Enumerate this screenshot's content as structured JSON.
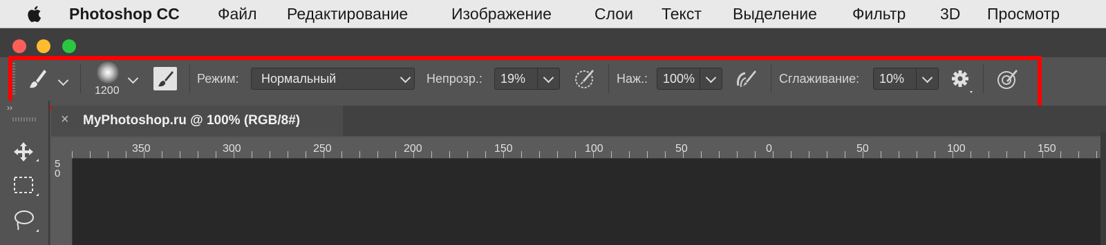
{
  "menubar": {
    "apple_icon": "apple-logo-icon",
    "app_name": "Photoshop CC",
    "items": [
      "Файл",
      "Редактирование",
      "Изображение",
      "Слои",
      "Текст",
      "Выделение",
      "Фильтр",
      "3D",
      "Просмотр"
    ]
  },
  "window": {
    "traffic_lights": {
      "close": "#fc5f57",
      "minimize": "#fdbc2e",
      "zoom": "#29c840"
    }
  },
  "options_bar": {
    "highlight_color": "#ff0000",
    "tool_icon": "brush-icon",
    "brush_size": "1200",
    "mode_label": "Режим:",
    "mode_value": "Нормальный",
    "opacity_label": "Непрозр.:",
    "opacity_value": "19%",
    "flow_label": "Наж.:",
    "flow_value": "100%",
    "smoothing_label": "Сглаживание:",
    "smoothing_value": "10%"
  },
  "document": {
    "tab_close": "×",
    "tab_title": "MyPhotoshop.ru @ 100% (RGB/8#)",
    "ruler_top": [
      "350",
      "300",
      "250",
      "200",
      "150",
      "100",
      "50",
      "0",
      "50",
      "100",
      "150"
    ],
    "ruler_left": [
      "5",
      "0"
    ]
  }
}
